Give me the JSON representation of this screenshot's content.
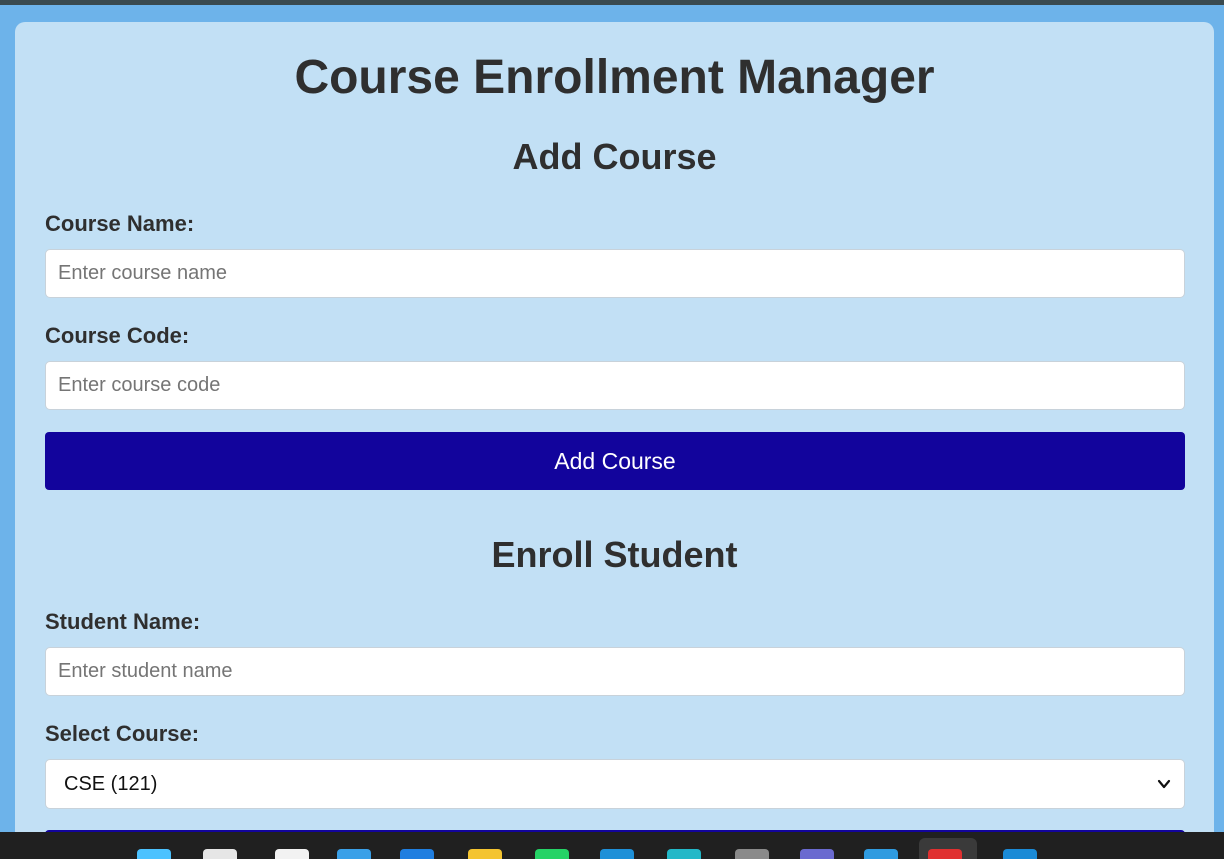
{
  "app": {
    "title": "Course Enrollment Manager"
  },
  "add_course": {
    "heading": "Add Course",
    "course_name_label": "Course Name:",
    "course_name_placeholder": "Enter course name",
    "course_name_value": "",
    "course_code_label": "Course Code:",
    "course_code_placeholder": "Enter course code",
    "course_code_value": "",
    "submit_label": "Add Course"
  },
  "enroll_student": {
    "heading": "Enroll Student",
    "student_name_label": "Student Name:",
    "student_name_placeholder": "Enter student name",
    "student_name_value": "",
    "select_course_label": "Select Course:",
    "selected_course": "CSE (121)"
  },
  "taskbar": {
    "icons": [
      {
        "name": "windows-start-icon",
        "color": "#4cc2ff"
      },
      {
        "name": "search-icon",
        "color": "#e6e6e6"
      },
      {
        "name": "task-view-icon",
        "color": "#f2f2f2"
      },
      {
        "name": "store-icon",
        "color": "#3aa0e8"
      },
      {
        "name": "edge-icon",
        "color": "#1f7ee0"
      },
      {
        "name": "file-explorer-icon",
        "color": "#f4c430"
      },
      {
        "name": "whatsapp-icon",
        "color": "#25d366"
      },
      {
        "name": "app-icon",
        "color": "#1e90d8"
      },
      {
        "name": "browser-icon",
        "color": "#22b8c8"
      },
      {
        "name": "shield-icon",
        "color": "#8a8a8a"
      },
      {
        "name": "notes-icon",
        "color": "#6a6ad0"
      },
      {
        "name": "chrome-icon",
        "color": "#2f9be0"
      },
      {
        "name": "chrome-profile-icon",
        "color": "#e03030"
      },
      {
        "name": "vscode-icon",
        "color": "#1a8ad6"
      }
    ]
  },
  "colors": {
    "page_background": "#6db3ea",
    "card_background": "#c2e0f5",
    "button_primary": "#12049c"
  }
}
